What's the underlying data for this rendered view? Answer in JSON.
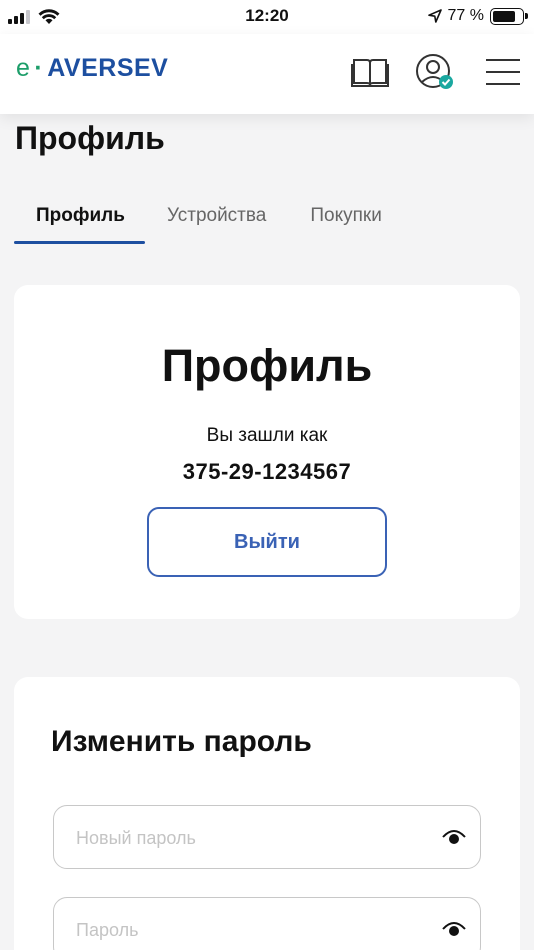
{
  "status_bar": {
    "time": "12:20",
    "battery": "77 %",
    "battery_level": 0.77
  },
  "header": {
    "logo_e": "e",
    "logo_dot": "·",
    "logo_brand": "AVERSEV",
    "icons": [
      "book-icon",
      "user-verified-icon",
      "menu-icon"
    ],
    "colors": {
      "brand_blue": "#1d4fa0",
      "brand_green": "#1d9e6a"
    }
  },
  "page": {
    "title": "Профиль"
  },
  "tabs": [
    {
      "label": "Профиль",
      "active": true
    },
    {
      "label": "Устройства",
      "active": false
    },
    {
      "label": "Покупки",
      "active": false
    }
  ],
  "profile_card": {
    "title": "Профиль",
    "logged_in_label": "Вы зашли как",
    "phone": "375-29-1234567",
    "logout_label": "Выйти"
  },
  "password_card": {
    "title": "Изменить пароль",
    "new_password_placeholder": "Новый пароль",
    "password_placeholder": "Пароль"
  }
}
